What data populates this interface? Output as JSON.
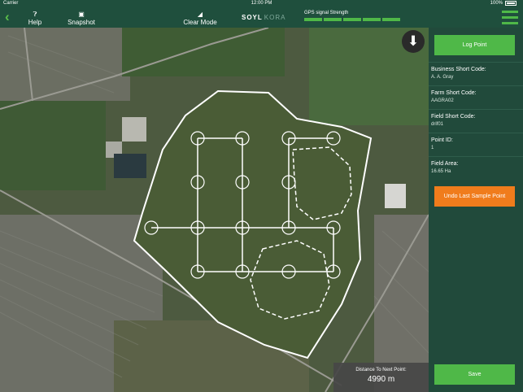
{
  "status": {
    "carrier": "Carrier",
    "time": "12:00 PM",
    "battery": "100%"
  },
  "toolbar": {
    "help_label": "Help",
    "snapshot_label": "Snapshot",
    "clear_mode_label": "Clear Mode",
    "brand_primary": "SOYL",
    "brand_secondary": "KORA",
    "gps_label": "GPS signal Strength",
    "gps_bars": 5
  },
  "map": {
    "distance_label": "Distance To Next Point:",
    "distance_value": "4990 m"
  },
  "sidebar": {
    "log_point_label": "Log Point",
    "fields": [
      {
        "label": "Business Short Code:",
        "value": "A. A. Gray"
      },
      {
        "label": "Farm Short Code:",
        "value": "AAGRA02"
      },
      {
        "label": "Field Short Code:",
        "value": "drif01"
      },
      {
        "label": "Point ID:",
        "value": "1"
      },
      {
        "label": "Field Area:",
        "value": "16.65 Ha"
      }
    ],
    "undo_label": "Undo Last Sample Point",
    "save_label": "Save"
  },
  "colors": {
    "accent_green": "#4fb848",
    "accent_orange": "#f07c1c",
    "panel": "#214a3b"
  }
}
